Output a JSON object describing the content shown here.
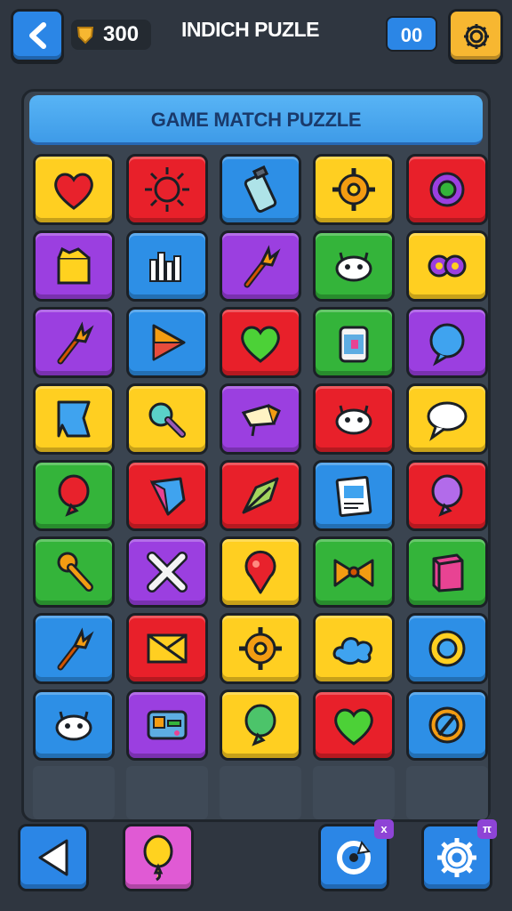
{
  "header": {
    "back_label": "back",
    "coins": "300",
    "title": "INDICH PUZLE",
    "score": "00"
  },
  "board": {
    "banner": "GAME MATCH PUZZLE",
    "tiles": [
      {
        "color": "yellow",
        "icon": "heart-icon"
      },
      {
        "color": "red",
        "icon": "sun-icon"
      },
      {
        "color": "blue",
        "icon": "bottle-icon"
      },
      {
        "color": "yellow",
        "icon": "gear-icon"
      },
      {
        "color": "red",
        "icon": "ring-gem-icon"
      },
      {
        "color": "purple",
        "icon": "box-icon"
      },
      {
        "color": "blue",
        "icon": "bars-icon"
      },
      {
        "color": "purple",
        "icon": "torch-icon"
      },
      {
        "color": "green",
        "icon": "creature-icon"
      },
      {
        "color": "yellow",
        "icon": "links-icon"
      },
      {
        "color": "purple",
        "icon": "torch-icon"
      },
      {
        "color": "blue",
        "icon": "play-triangle-icon"
      },
      {
        "color": "red",
        "icon": "heart-icon"
      },
      {
        "color": "green",
        "icon": "jar-icon"
      },
      {
        "color": "purple",
        "icon": "bubble-icon"
      },
      {
        "color": "yellow",
        "icon": "flag-icon"
      },
      {
        "color": "yellow",
        "icon": "key-icon"
      },
      {
        "color": "purple",
        "icon": "horn-icon"
      },
      {
        "color": "red",
        "icon": "creature-icon"
      },
      {
        "color": "yellow",
        "icon": "speech-icon"
      },
      {
        "color": "green",
        "icon": "balloon-icon"
      },
      {
        "color": "red",
        "icon": "diamond-icon"
      },
      {
        "color": "red",
        "icon": "leaf-icon"
      },
      {
        "color": "blue",
        "icon": "card-icon"
      },
      {
        "color": "red",
        "icon": "balloon-icon"
      },
      {
        "color": "green",
        "icon": "wrench-icon"
      },
      {
        "color": "purple",
        "icon": "cross-icon"
      },
      {
        "color": "yellow",
        "icon": "pin-icon"
      },
      {
        "color": "green",
        "icon": "bow-icon"
      },
      {
        "color": "green",
        "icon": "cube-icon"
      },
      {
        "color": "blue",
        "icon": "torch-icon"
      },
      {
        "color": "red",
        "icon": "envelope-icon"
      },
      {
        "color": "yellow",
        "icon": "gear-icon"
      },
      {
        "color": "yellow",
        "icon": "cloud-icon"
      },
      {
        "color": "blue",
        "icon": "badge-icon"
      },
      {
        "color": "blue",
        "icon": "creature-icon"
      },
      {
        "color": "purple",
        "icon": "console-icon"
      },
      {
        "color": "yellow",
        "icon": "balloon-icon"
      },
      {
        "color": "red",
        "icon": "heart-icon"
      },
      {
        "color": "blue",
        "icon": "compass-icon"
      }
    ]
  },
  "bottom": {
    "left_badge": "x",
    "right_badge": "π"
  },
  "colors": {
    "yellow": "#ffcf21",
    "red": "#e8202a",
    "blue": "#2d8fe6",
    "purple": "#9b3fe0",
    "green": "#34b43a"
  }
}
